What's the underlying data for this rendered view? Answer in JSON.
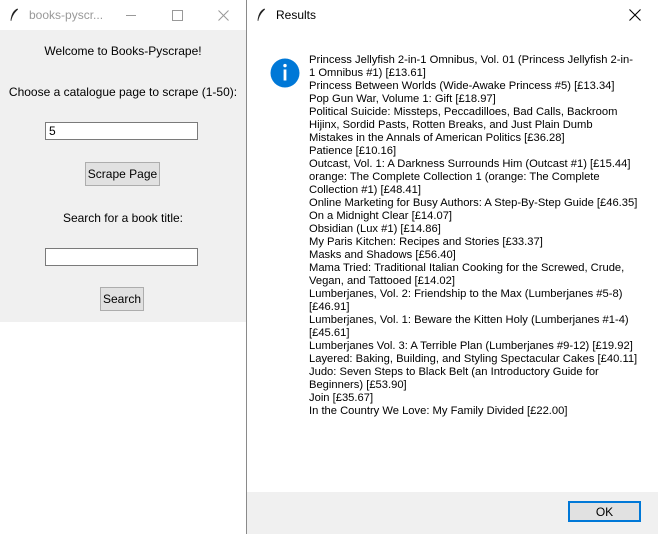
{
  "main_window": {
    "title": "books-pyscr...",
    "welcome": "Welcome to Books-Pyscrape!",
    "page_prompt": "Choose a catalogue page to scrape (1-50):",
    "page_value": "5",
    "scrape_label": "Scrape Page",
    "search_prompt": "Search for a book title:",
    "search_value": "",
    "search_label": "Search"
  },
  "dialog": {
    "title": "Results",
    "ok_label": "OK",
    "results": [
      "Princess Jellyfish 2-in-1 Omnibus, Vol. 01 (Princess Jellyfish 2-in-1 Omnibus #1) [£13.61]",
      "Princess Between Worlds (Wide-Awake Princess #5) [£13.34]",
      "Pop Gun War, Volume 1: Gift [£18.97]",
      "Political Suicide: Missteps, Peccadilloes, Bad Calls, Backroom Hijinx, Sordid Pasts, Rotten Breaks, and Just Plain Dumb Mistakes in the Annals of American Politics [£36.28]",
      "Patience [£10.16]",
      "Outcast, Vol. 1: A Darkness Surrounds Him (Outcast #1) [£15.44]",
      "orange: The Complete Collection 1 (orange: The Complete Collection #1) [£48.41]",
      "Online Marketing for Busy Authors: A Step-By-Step Guide [£46.35]",
      "On a Midnight Clear [£14.07]",
      "Obsidian (Lux #1) [£14.86]",
      "My Paris Kitchen: Recipes and Stories [£33.37]",
      "Masks and Shadows [£56.40]",
      "Mama Tried: Traditional Italian Cooking for the Screwed, Crude, Vegan, and Tattooed [£14.02]",
      "Lumberjanes, Vol. 2: Friendship to the Max (Lumberjanes #5-8) [£46.91]",
      "Lumberjanes, Vol. 1: Beware the Kitten Holy (Lumberjanes #1-4) [£45.61]",
      "Lumberjanes Vol. 3: A Terrible Plan (Lumberjanes #9-12) [£19.92]",
      "Layered: Baking, Building, and Styling Spectacular Cakes [£40.11]",
      "Judo: Seven Steps to Black Belt (an Introductory Guide for Beginners) [£53.90]",
      "Join [£35.67]",
      "In the Country We Love: My Family Divided [£22.00]"
    ]
  },
  "icons": {
    "app_icon": "feather-icon",
    "info_icon": "info-icon"
  },
  "colors": {
    "info_blue": "#0078d7",
    "window_bg": "#f0f0f0"
  }
}
